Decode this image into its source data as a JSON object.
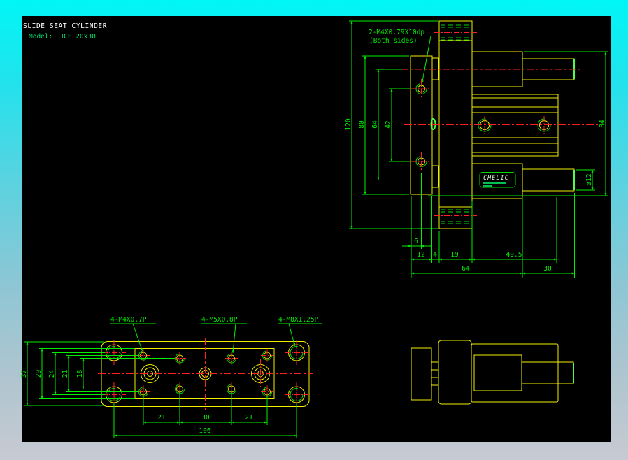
{
  "titleblock": {
    "title": "SLIDE SEAT CYLINDER",
    "model_label": "Model:",
    "model_value": "JCF 20x30"
  },
  "brand": {
    "name": "CHELIC"
  },
  "views": {
    "side": {
      "note_line1": "2-M4X0.79X10dp",
      "note_line2": "(Both sides)",
      "dims": {
        "height_overall": "120",
        "plate_height": "80",
        "port_centers": "64",
        "hole_centers": "42",
        "rod_span": "84",
        "rod_dia": "ø12",
        "hole_offset": "6",
        "plate_thk": "12",
        "gap": "4",
        "block_w": "19",
        "body_w": "49.5",
        "base_len": "64",
        "stroke_len": "30"
      }
    },
    "plan": {
      "notes": {
        "m4": "4-M4X0.7P",
        "m5": "4-M5X0.8P",
        "m8": "4-M8X1.25P"
      },
      "dims": {
        "w37": "37",
        "w29": "29",
        "w24": "24",
        "w21": "21",
        "w18": "18",
        "p21a": "21",
        "p30": "30",
        "p21b": "21",
        "p106": "106"
      }
    }
  },
  "colors": {
    "canvas": "#000000",
    "outline": "#f0f000",
    "dimension": "#00ef00",
    "centerline": "#ff2121",
    "title_text": "#ffffff",
    "model_text": "#00e070",
    "brand_text": "#dcffdc",
    "frame_top": "#00f6f6",
    "frame_bottom": "#c7cad2"
  }
}
